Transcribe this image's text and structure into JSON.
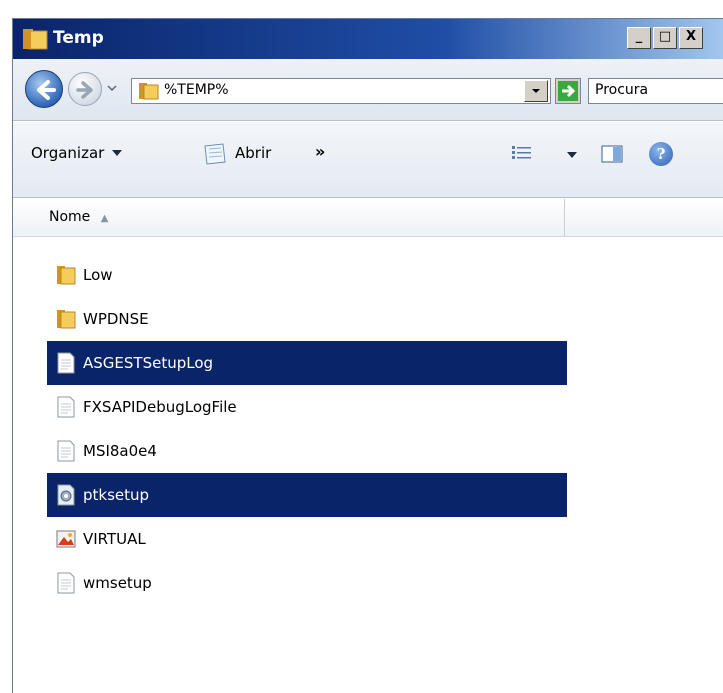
{
  "window": {
    "title": "Temp",
    "controls": {
      "minimize": "_",
      "maximize": "□",
      "close": "X"
    }
  },
  "address": {
    "path": "%TEMP%",
    "search_placeholder": "Procura"
  },
  "toolbar": {
    "organize_label": "Organizar",
    "open_label": "Abrir",
    "more_label": "»",
    "help_label": "?"
  },
  "columns": {
    "name": "Nome",
    "sort": "▲"
  },
  "files": [
    {
      "name": "Low",
      "type": "folder",
      "selected": false
    },
    {
      "name": "WPDNSE",
      "type": "folder",
      "selected": false
    },
    {
      "name": "ASGESTSetupLog",
      "type": "text",
      "selected": true
    },
    {
      "name": "FXSAPIDebugLogFile",
      "type": "text",
      "selected": false
    },
    {
      "name": "MSI8a0e4",
      "type": "text",
      "selected": false
    },
    {
      "name": "ptksetup",
      "type": "config",
      "selected": true
    },
    {
      "name": "VIRTUAL",
      "type": "image",
      "selected": false
    },
    {
      "name": "wmsetup",
      "type": "text",
      "selected": false
    }
  ],
  "colors": {
    "selection": "#0a246a",
    "titlebar_start": "#0a246a",
    "titlebar_end": "#a6caf0"
  }
}
